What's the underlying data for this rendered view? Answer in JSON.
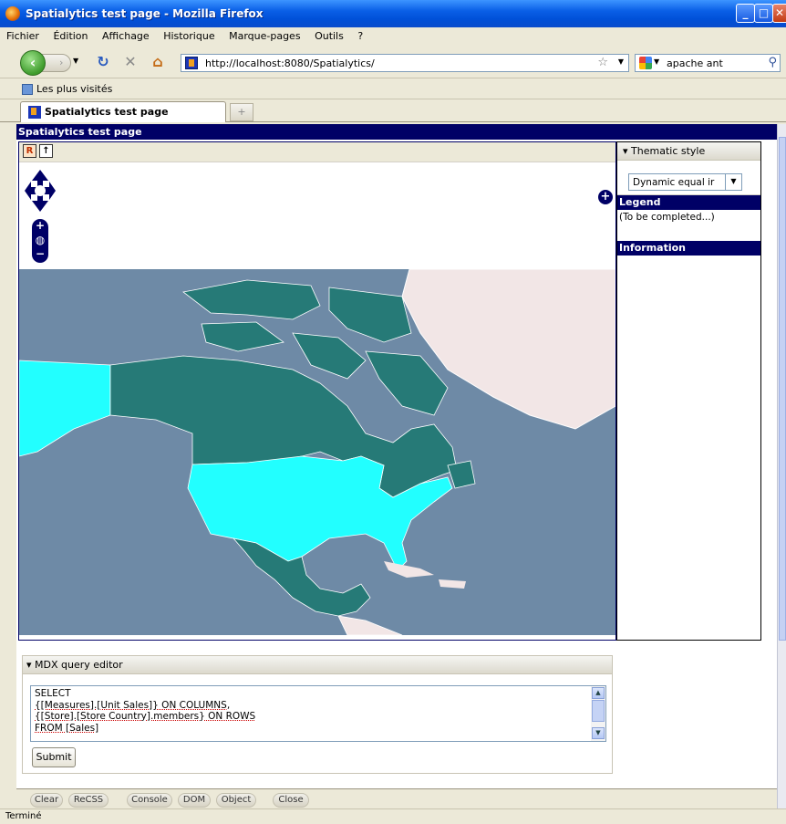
{
  "window": {
    "title": "Spatialytics test page - Mozilla Firefox"
  },
  "menu": [
    "Fichier",
    "Édition",
    "Affichage",
    "Historique",
    "Marque-pages",
    "Outils",
    "?"
  ],
  "nav": {
    "url": "http://localhost:8080/Spatialytics/",
    "search_value": "apache ant"
  },
  "bookmarks": {
    "item": "Les plus visités"
  },
  "tabs": [
    {
      "label": "Spatialytics test page"
    }
  ],
  "page": {
    "header": "Spatialytics test page"
  },
  "map": {
    "tool_icons": [
      "layer-switcher-icon",
      "up-arrow-icon"
    ]
  },
  "sidebar": {
    "thematic": {
      "title": "Thematic style",
      "selected": "Dynamic equal ir"
    },
    "legend": {
      "title": "Legend",
      "text": "(To be completed...)"
    },
    "information": {
      "title": "Information"
    }
  },
  "mdx": {
    "title": "MDX query editor",
    "lines": [
      "SELECT",
      "{[Measures].[Unit Sales]} ON COLUMNS,",
      "{[Store].[Store Country].members} ON ROWS",
      "FROM [Sales]"
    ],
    "submit_label": "Submit"
  },
  "firebug": [
    "Clear",
    "ReCSS",
    "Console",
    "DOM",
    "Object",
    "Close"
  ],
  "status": "Terminé",
  "colors": {
    "highlight": "#22ffff",
    "land": "#267a77",
    "ocean": "#6e8aa6",
    "greenland": "#f2e6e6",
    "panel_header": "#000066"
  }
}
